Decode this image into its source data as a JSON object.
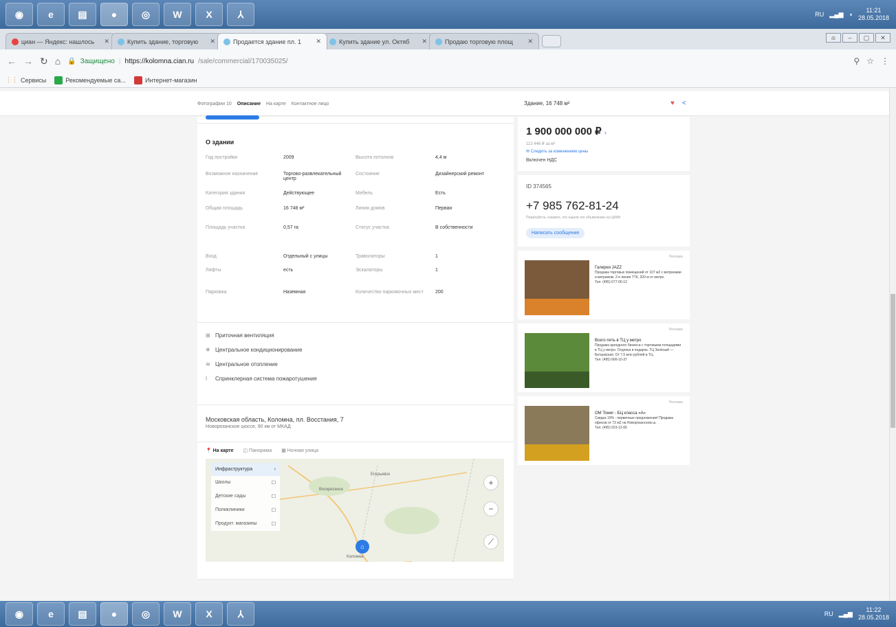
{
  "taskbar": {
    "clock_time": "11:21",
    "clock_date": "28.05.2018",
    "clock_time_bottom": "11:22",
    "clock_date_bottom": "28.05.2018",
    "lang": "RU"
  },
  "tabs": [
    {
      "title": "циан — Яндекс: нашлось",
      "active": false
    },
    {
      "title": "Купить здание, торговую",
      "active": false
    },
    {
      "title": "Продается здание пл. 1",
      "active": true
    },
    {
      "title": "Купить здание ул. Октяб",
      "active": false
    },
    {
      "title": "Продаю торговую площ",
      "active": false
    }
  ],
  "address_bar": {
    "secure_label": "Защищено",
    "url_domain": "https://kolomna.cian.ru",
    "url_path": "/sale/commercial/170035025/"
  },
  "bookmarks": [
    {
      "label": "Сервисы"
    },
    {
      "label": "Рекомендуемые са..."
    },
    {
      "label": "Интернет-магазин"
    }
  ],
  "subnav": {
    "links": [
      "Фотографии 10",
      "Описание",
      "На карте",
      "Контактное лицо"
    ],
    "building_name": "Здание, 16 748 м²"
  },
  "building": {
    "title": "О здании",
    "rows": [
      {
        "l1": "Год постройки",
        "v1": "2009",
        "l2": "Высота потолков",
        "v2": "4,4 м"
      },
      {
        "l1": "Возможное назначение",
        "v1": "Торгово-развлекательный центр",
        "l2": "Состояние",
        "v2": "Дизайнерский ремонт"
      },
      {
        "l1": "Категория здания",
        "v1": "Действующее",
        "l2": "Мебель",
        "v2": "Есть"
      },
      {
        "l1": "Общая площадь",
        "v1": "16 748 м²",
        "l2": "Линия домов",
        "v2": "Первая"
      },
      {
        "l1": "Площадь участка",
        "v1": "0,57 га",
        "l2": "Статус участка",
        "v2": "В собственности"
      },
      {
        "l1": "Вход",
        "v1": "Отдельный с улицы",
        "l2": "Траволаторы",
        "v2": "1"
      },
      {
        "l1": "Лифты",
        "v1": "есть",
        "l2": "Эскалаторы",
        "v2": "1"
      },
      {
        "l1": "Парковка",
        "v1": "Наземная",
        "l2": "Количество парковочных мест",
        "v2": "200"
      }
    ]
  },
  "features": [
    {
      "icon": "ventilation-icon",
      "glyph": "⊞",
      "label": "Приточная вентиляция"
    },
    {
      "icon": "ac-icon",
      "glyph": "❄",
      "label": "Центральное кондиционирование"
    },
    {
      "icon": "heating-icon",
      "glyph": "≋",
      "label": "Центральное отопление"
    },
    {
      "icon": "sprinkler-icon",
      "glyph": "ǀ",
      "label": "Спринклерная система пожаротушения"
    }
  ],
  "address": {
    "line1": "Московская область, Коломна, пл. Восстания, 7",
    "line2": "Новорязанское шоссе, 90 км от МКАД"
  },
  "map": {
    "tabs": [
      "На карте",
      "Панорама",
      "Ночная улица"
    ],
    "legend": [
      "Инфраструктура",
      "Школы",
      "Детские сады",
      "Поликлиники",
      "Продукт. магазины"
    ],
    "labels": [
      "Коломна",
      "Воскресенск",
      "Егорьевск"
    ]
  },
  "sidebar": {
    "price": "1 900 000 000 ₽",
    "price_per_m2": "113 446 ₽ за м²",
    "notify_label": "Следить за изменением цены",
    "vat": "Включен НДС",
    "offer_id": "ID 374565",
    "phone": "+7 985 762-81-24",
    "phone_note": "Пожалуйста, скажите, что нашли это объявление на ЦИАН",
    "message_button": "Написать сообщение"
  },
  "ads": [
    {
      "label": "Реклама",
      "title": "Галерея JAZZ",
      "text": "Продажа торговых помещений от 107 м2 с витринами и витражом. 2-я линия ТТК, 200 м от метро.",
      "phone": "Тел: (495) 677-00-12",
      "color_top": "#7a5a3a",
      "color_bottom": "#d9822b"
    },
    {
      "label": "Реклама",
      "title": "Всего пять в ТЦ у метро",
      "text": "Продажа арендного бизнеса с торговыми площадями в ТЦ у метро. Отделка в подарок. ТЦ Зелёный — Битцевская. От 7,5 млн рублей в ТЦ.",
      "phone": "Тел: (495) 666-10-37",
      "color_top": "#5a8a3a",
      "color_bottom": "#3a5a28"
    },
    {
      "label": "Реклама",
      "title": "ОМ Tower - БЦ класса «А»",
      "text": "Скидка 10% - первичные предложения! Продажа офисов от 72 м2 на Новорязанском ш.",
      "phone": "Тел: (495) 023-12-65",
      "color_top": "#8a7a5a",
      "color_bottom": "#d4a020"
    }
  ]
}
